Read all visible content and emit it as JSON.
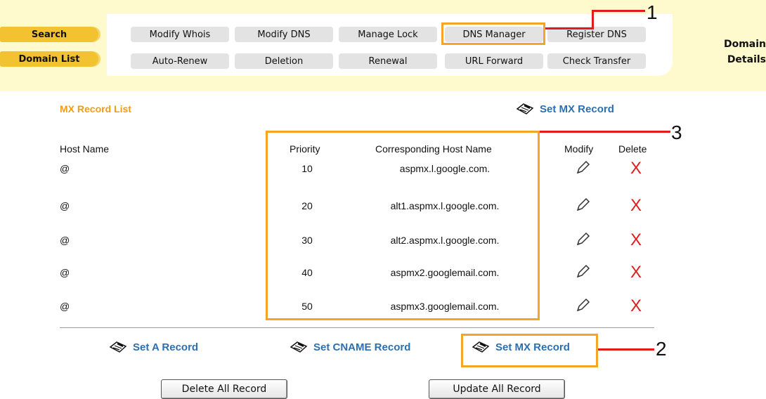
{
  "sidebar": {
    "search": "Search",
    "domain_list": "Domain List"
  },
  "tabs_row1": [
    "Modify Whois",
    "Modify DNS",
    "Manage Lock",
    "DNS Manager",
    "Register DNS"
  ],
  "tabs_row2": [
    "Auto-Renew",
    "Deletion",
    "Renewal",
    "URL Forward",
    "Check Transfer"
  ],
  "header_right": {
    "line1": "Domain",
    "line2": "Details"
  },
  "section": {
    "title": "MX Record List",
    "set_mx_top": "Set MX Record"
  },
  "table": {
    "headers": [
      "Host Name",
      "Priority",
      "Corresponding Host Name",
      "Modify",
      "Delete"
    ],
    "rows": [
      {
        "host": "@",
        "priority": "10",
        "target": "aspmx.l.google.com."
      },
      {
        "host": "@",
        "priority": "20",
        "target": "alt1.aspmx.l.google.com."
      },
      {
        "host": "@",
        "priority": "30",
        "target": "alt2.aspmx.l.google.com."
      },
      {
        "host": "@",
        "priority": "40",
        "target": "aspmx2.googlemail.com."
      },
      {
        "host": "@",
        "priority": "50",
        "target": "aspmx3.googlemail.com."
      }
    ]
  },
  "bottom_links": {
    "set_a": "Set A Record",
    "set_cname": "Set CNAME Record",
    "set_mx": "Set MX Record"
  },
  "buttons": {
    "delete_all": "Delete All Record",
    "update_all": "Update All Record"
  },
  "annotations": {
    "n1": "1",
    "n2": "2",
    "n3": "3"
  },
  "colors": {
    "highlight": "#f5a425",
    "callout": "#e21b1b",
    "link": "#2c6fb0",
    "title": "#f39c12",
    "band": "#fffacd",
    "side_button": "#f2c230"
  }
}
